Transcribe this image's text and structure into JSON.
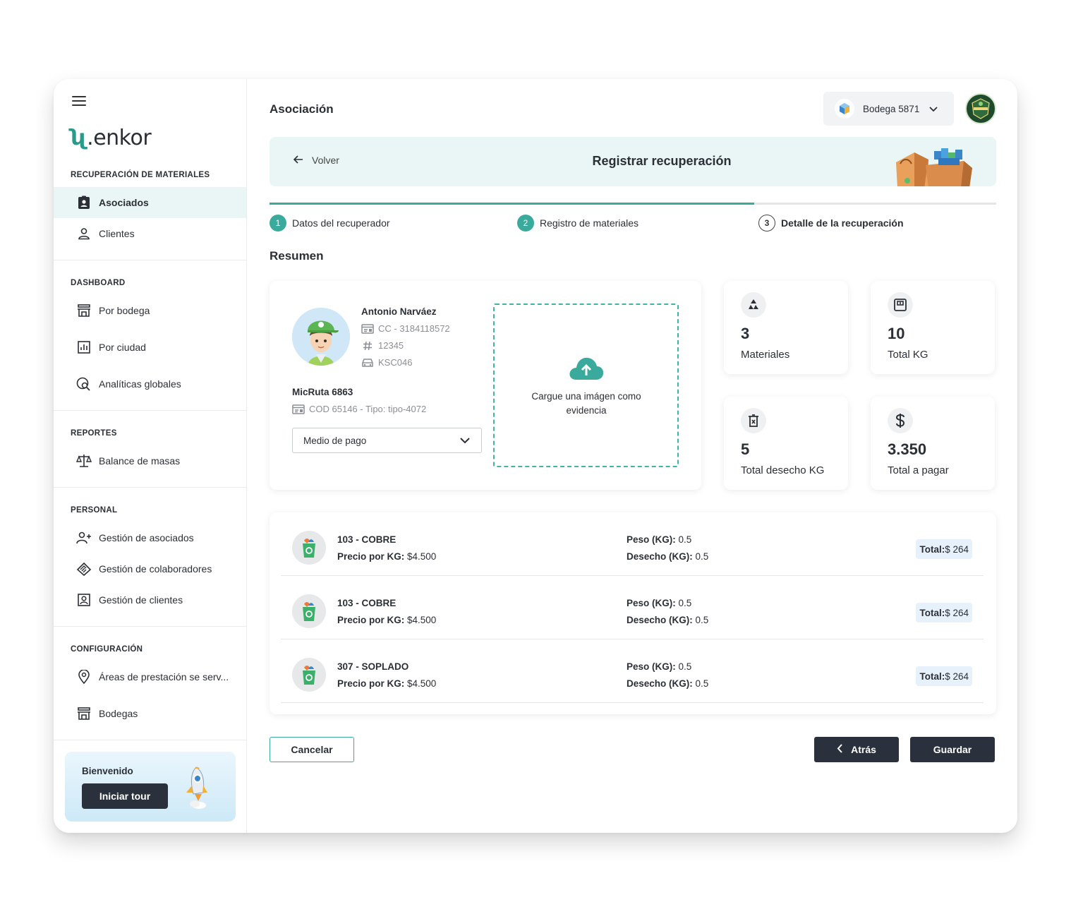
{
  "brand": {
    "logo_mark": "ʯ",
    "logo_text": ".enkor"
  },
  "sidebar": {
    "sections": [
      {
        "title": "RECUPERACIÓN DE MATERIALES"
      },
      {
        "title": "DASHBOARD"
      },
      {
        "title": "REPORTES"
      },
      {
        "title": "PERSONAL"
      },
      {
        "title": "CONFIGURACIÓN"
      }
    ],
    "items": {
      "asociados": {
        "label": "Asociados",
        "icon": "badge-icon",
        "active": true
      },
      "clientes": {
        "label": "Clientes",
        "icon": "person-icon"
      },
      "por_bodega": {
        "label": "Por bodega",
        "icon": "store-icon"
      },
      "por_ciudad": {
        "label": "Por ciudad",
        "icon": "bar-chart-icon"
      },
      "analiticas": {
        "label": "Analíticas globales",
        "icon": "globe-search-icon"
      },
      "balance": {
        "label": "Balance de masas",
        "icon": "scale-icon"
      },
      "gestion_asociados": {
        "label": "Gestión de asociados",
        "icon": "person-add-icon"
      },
      "gestion_colaboradores": {
        "label": "Gestión de colaboradores",
        "icon": "handshake-icon"
      },
      "gestion_clientes": {
        "label": "Gestión de clientes",
        "icon": "contact-card-icon"
      },
      "areas": {
        "label": "Áreas de prestación se serv...",
        "icon": "location-pin-icon"
      },
      "bodegas": {
        "label": "Bodegas",
        "icon": "store-icon"
      }
    },
    "welcome": {
      "title": "Bienvenido",
      "button": "Iniciar tour"
    }
  },
  "header": {
    "title": "Asociación",
    "bodega_select": "Bodega 5871"
  },
  "banner": {
    "back": "Volver",
    "title": "Registrar recuperación"
  },
  "stepper": {
    "progress_fraction": 0.667,
    "steps": [
      {
        "num": "1",
        "label": "Datos del recuperador",
        "state": "done"
      },
      {
        "num": "2",
        "label": "Registro de materiales",
        "state": "done"
      },
      {
        "num": "3",
        "label": "Detalle de la recuperación",
        "state": "current"
      }
    ]
  },
  "summary": {
    "heading": "Resumen",
    "person": {
      "name": "Antonio Narváez",
      "id": "CC - 3184118572",
      "number": "12345",
      "plate": "KSC046"
    },
    "route": {
      "name": "MicRuta 6863",
      "detail": "COD 65146 - Tipo: tipo-4072"
    },
    "payment_select": "Medio de pago",
    "upload_text": "Cargue una imágen como evidencia",
    "stats": [
      {
        "value": "3",
        "label": "Materiales",
        "icon": "recycle-icon"
      },
      {
        "value": "10",
        "label": "Total KG",
        "icon": "scale-weight-icon"
      },
      {
        "value": "5",
        "label": "Total desecho KG",
        "icon": "trash-icon"
      },
      {
        "value": "3.350",
        "label": "Total a pagar",
        "icon": "dollar-icon"
      }
    ]
  },
  "materials": [
    {
      "name": "103 - COBRE",
      "price_label": "Precio por KG:",
      "price": " $4.500",
      "weight_label": "Peso (KG):",
      "weight": " 0.5",
      "waste_label": "Desecho (KG):",
      "waste": " 0.5",
      "total_label": "Total:",
      "total": " $ 264"
    },
    {
      "name": "103 - COBRE",
      "price_label": "Precio por KG:",
      "price": " $4.500",
      "weight_label": "Peso (KG):",
      "weight": " 0.5",
      "waste_label": "Desecho (KG):",
      "waste": " 0.5",
      "total_label": "Total:",
      "total": " $ 264"
    },
    {
      "name": "307 - SOPLADO",
      "price_label": "Precio por KG:",
      "price": " $4.500",
      "weight_label": "Peso (KG):",
      "weight": " 0.5",
      "waste_label": "Desecho (KG):",
      "waste": " 0.5",
      "total_label": "Total:",
      "total": " $ 264"
    }
  ],
  "actions": {
    "cancel": "Cancelar",
    "back": "Atrás",
    "save": "Guardar"
  },
  "colors": {
    "accent": "#3aaa9d",
    "dark": "#2a313d",
    "banner_bg": "#eaf6f5"
  }
}
